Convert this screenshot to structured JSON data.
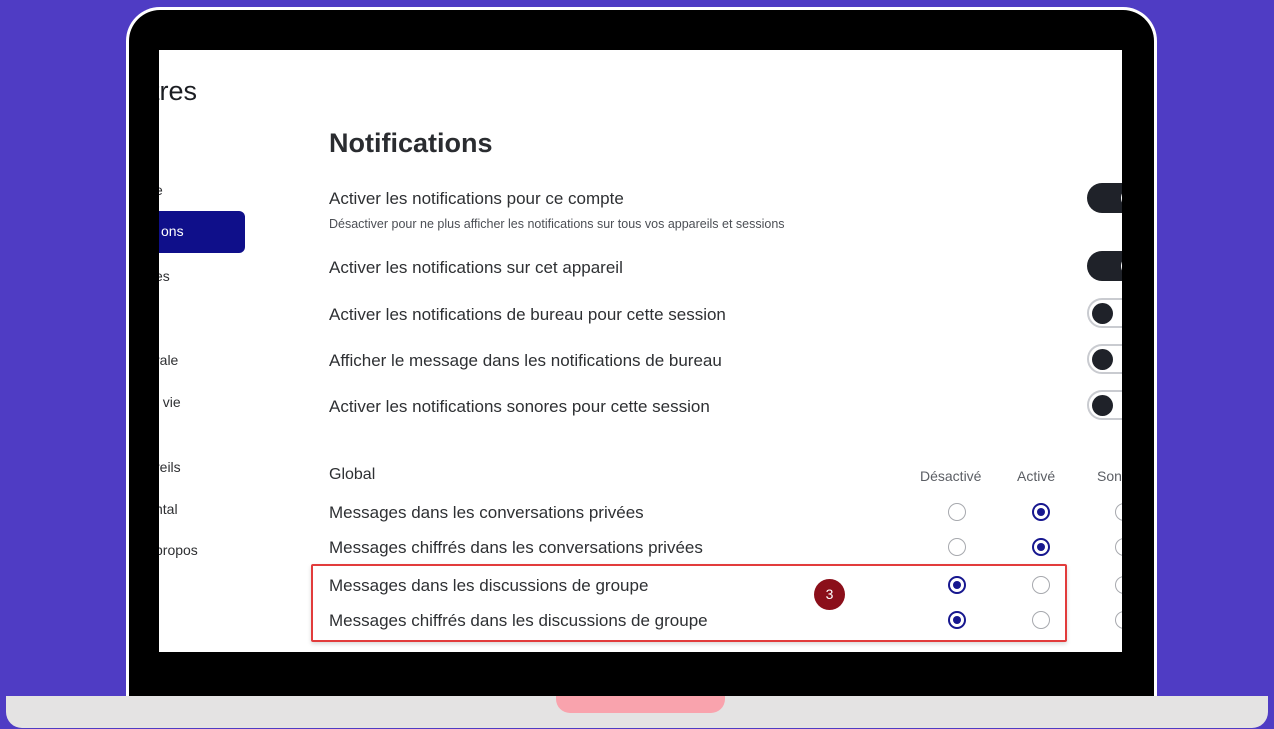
{
  "sidebar": {
    "title": "tres",
    "items": [
      {
        "label": "e",
        "active": false
      },
      {
        "label": "ons",
        "active": true
      },
      {
        "label": "es",
        "active": false
      },
      {
        "label": "rale",
        "active": false
      },
      {
        "label": "t vie",
        "active": false
      },
      {
        "label": "reils",
        "active": false
      },
      {
        "label": "ntal",
        "active": false
      },
      {
        "label": "propos",
        "active": false
      }
    ]
  },
  "main": {
    "heading": "Notifications",
    "settings": [
      {
        "label": "Activer les notifications pour ce compte",
        "sub": "Désactiver pour ne plus afficher les notifications sur tous vos appareils et sessions",
        "toggle": "on"
      },
      {
        "label": "Activer les notifications sur cet appareil",
        "toggle": "on"
      },
      {
        "label": "Activer les notifications de bureau pour cette session",
        "toggle": "off"
      },
      {
        "label": "Afficher le message dans les notifications de bureau",
        "toggle": "off"
      },
      {
        "label": "Activer les notifications sonores pour cette session",
        "toggle": "off"
      }
    ],
    "global": {
      "label": "Global",
      "columns": [
        "Désactivé",
        "Activé",
        "Son"
      ],
      "rows": [
        {
          "label": "Messages dans les conversations privées",
          "selected": "Activé"
        },
        {
          "label": "Messages chiffrés dans les conversations privées",
          "selected": "Activé"
        },
        {
          "label": "Messages dans les discussions de groupe",
          "selected": "Désactivé"
        },
        {
          "label": "Messages chiffrés dans les discussions de groupe",
          "selected": "Désactivé"
        }
      ]
    }
  },
  "annotation": {
    "step": "3",
    "color": "#e23c3c",
    "badge_color": "#8b0f1a"
  },
  "colors": {
    "background": "#4f3cc4",
    "accent": "#0f0f8a",
    "laptop_notch": "#f9a3ad"
  }
}
